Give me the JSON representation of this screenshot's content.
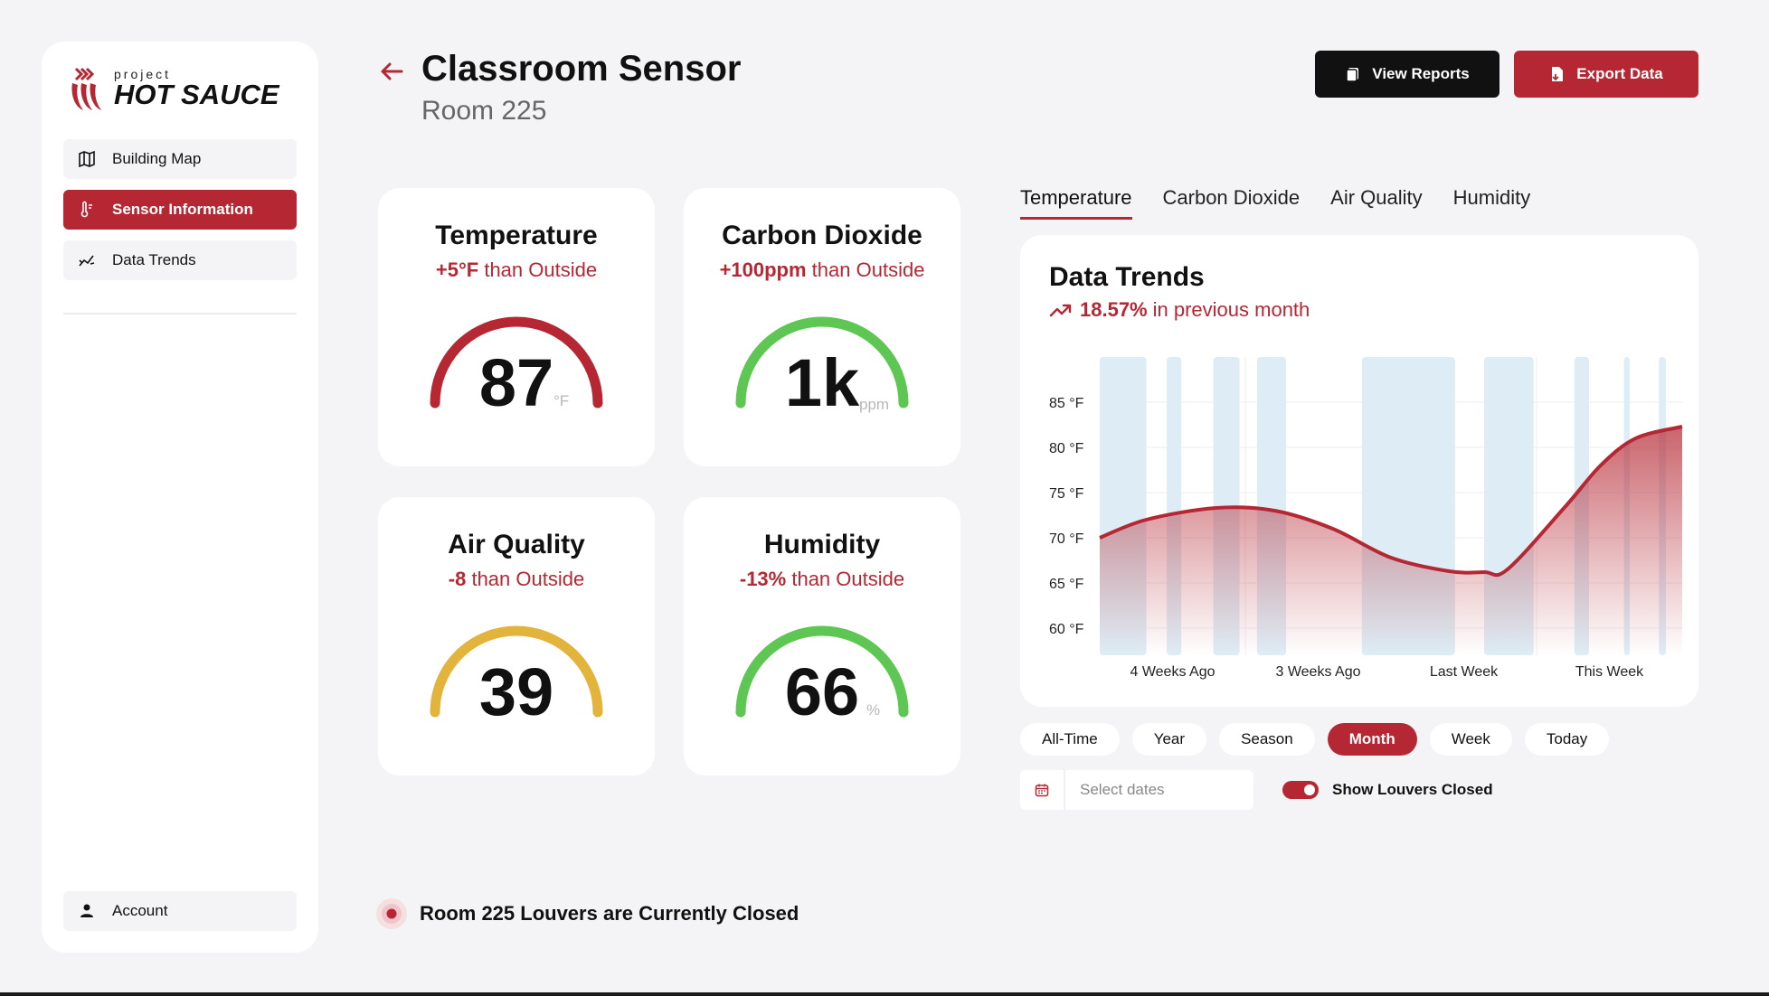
{
  "brand": {
    "small": "project",
    "big": "HOT SAUCE"
  },
  "sidebar": {
    "items": [
      {
        "label": "Building Map",
        "icon": "map-icon"
      },
      {
        "label": "Sensor Information",
        "icon": "thermometer-icon",
        "active": true
      },
      {
        "label": "Data Trends",
        "icon": "trend-icon"
      }
    ],
    "account_label": "Account"
  },
  "header": {
    "title": "Classroom Sensor",
    "subtitle": "Room 225",
    "view_reports": "View Reports",
    "export_data": "Export Data"
  },
  "cards": {
    "temperature": {
      "title": "Temperature",
      "delta": "+5°F",
      "delta_suffix": " than Outside",
      "value": "87",
      "unit": "°F",
      "color": "#b52833",
      "level": 1.0
    },
    "co2": {
      "title": "Carbon Dioxide",
      "delta": "+100ppm",
      "delta_suffix": " than Outside",
      "value": "1k",
      "unit": "ppm",
      "color": "#5ec653",
      "level": 1.0
    },
    "air": {
      "title": "Air Quality",
      "delta": "-8",
      "delta_suffix": " than Outside",
      "value": "39",
      "unit": "",
      "color": "#e3b43c",
      "level": 1.0
    },
    "humidity": {
      "title": "Humidity",
      "delta": "-13%",
      "delta_suffix": " than Outside",
      "value": "66",
      "unit": "%",
      "color": "#5ec653",
      "level": 1.0
    }
  },
  "tabs": [
    "Temperature",
    "Carbon Dioxide",
    "Air Quality",
    "Humidity"
  ],
  "chart_panel": {
    "title": "Data Trends",
    "delta_value": "18.57%",
    "delta_text": "in previous month"
  },
  "chart_data": {
    "type": "area",
    "title": "Data Trends",
    "y_ticks": [
      "85 °F",
      "80 °F",
      "75 °F",
      "70 °F",
      "65 °F",
      "60 °F"
    ],
    "ylim": [
      57,
      89
    ],
    "x_tick_labels": [
      "4 Weeks Ago",
      "3 Weeks Ago",
      "Last Week",
      "This Week"
    ],
    "series": [
      {
        "x": [
          0,
          0.08,
          0.2,
          0.3,
          0.4,
          0.5,
          0.6,
          0.66,
          0.7,
          0.8,
          0.86,
          0.92,
          1.0
        ],
        "y": [
          70,
          72,
          73.3,
          73,
          71,
          67.8,
          66.3,
          66.2,
          66.5,
          73.5,
          78,
          81,
          82.3
        ]
      }
    ],
    "louvers_closed_bands": [
      [
        0,
        0.08
      ],
      [
        0.115,
        0.14
      ],
      [
        0.195,
        0.24
      ],
      [
        0.27,
        0.32
      ],
      [
        0.45,
        0.61
      ],
      [
        0.66,
        0.745
      ],
      [
        0.815,
        0.84
      ],
      [
        0.9,
        0.91
      ],
      [
        0.96,
        0.972
      ]
    ],
    "colors": {
      "line": "#b52833",
      "band": "#dcecf4"
    }
  },
  "ranges": [
    "All-Time",
    "Year",
    "Season",
    "Month",
    "Week",
    "Today"
  ],
  "active_range": "Month",
  "date_placeholder": "Select dates",
  "toggle_label": "Show Louvers Closed",
  "status": "Room 225 Louvers are Currently Closed"
}
